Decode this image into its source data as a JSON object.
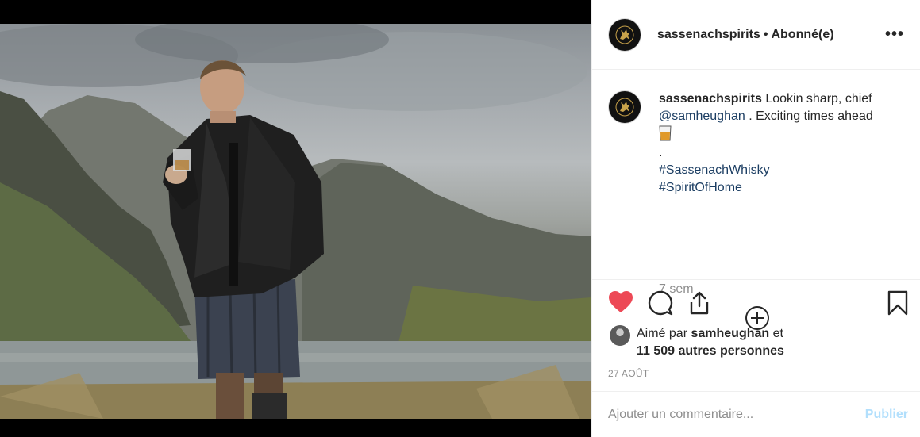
{
  "post": {
    "username": "sassenachspirits",
    "separator": "•",
    "follow_status": "Abonné(e)",
    "more_icon": "more-horizontal-icon"
  },
  "caption": {
    "username": "sassenachspirits",
    "text_before": "Lookin sharp, chief",
    "mention": "@samheughan",
    "text_after": ". Exciting times ahead",
    "emoji": "whisky-glass-icon",
    "dot": ".",
    "hashtags": [
      "#SassenachWhisky",
      "#SpiritOfHome"
    ],
    "time_ago": "7 sem"
  },
  "actions": {
    "like_icon": "heart-filled-icon",
    "comment_icon": "comment-icon",
    "share_icon": "share-icon",
    "save_icon": "bookmark-icon",
    "liked_color": "#ed4956"
  },
  "likes": {
    "prefix": "Aimé par",
    "user": "samheughan",
    "and": "et",
    "others": "11 509 autres personnes"
  },
  "date": "27 AOÛT",
  "comment": {
    "placeholder": "Ajouter un commentaire...",
    "publish_label": "Publier"
  },
  "colors": {
    "link": "#1c3e63",
    "muted": "#8e8e8e",
    "publish_disabled": "#b2dffc"
  }
}
